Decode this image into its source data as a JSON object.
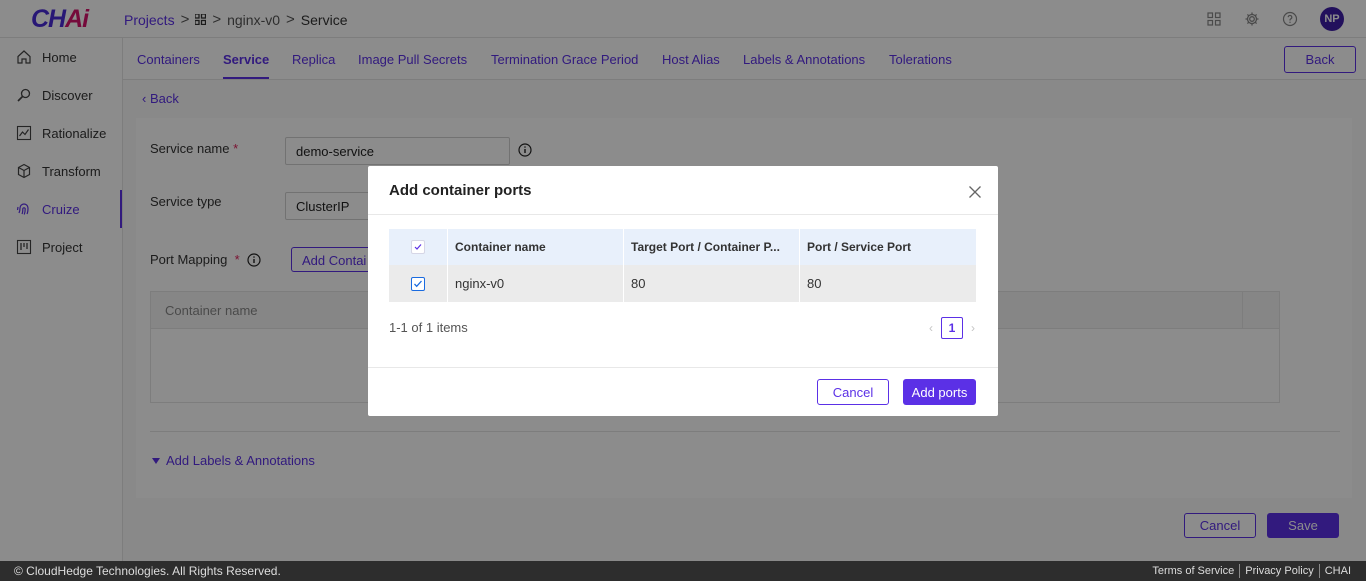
{
  "app": {
    "logo_main": "CH",
    "logo_accent": "Ai"
  },
  "breadcrumb": {
    "projects": "Projects",
    "app_name": "nginx-v0",
    "current": "Service",
    "sep": ">"
  },
  "header": {
    "avatar_initials": "NP"
  },
  "sidebar": {
    "items": [
      {
        "label": "Home",
        "icon": "home-icon"
      },
      {
        "label": "Discover",
        "icon": "discover-icon"
      },
      {
        "label": "Rationalize",
        "icon": "chart-icon"
      },
      {
        "label": "Transform",
        "icon": "cube-icon"
      },
      {
        "label": "Cruize",
        "icon": "fingerprint-icon",
        "active": true
      },
      {
        "label": "Project",
        "icon": "project-icon"
      }
    ]
  },
  "tabs": {
    "items": [
      "Containers",
      "Service",
      "Replica",
      "Image Pull Secrets",
      "Termination Grace Period",
      "Host Alias",
      "Labels & Annotations",
      "Tolerations"
    ],
    "active": "Service",
    "back_button": "Back"
  },
  "form": {
    "back_link": "Back",
    "service_name_label": "Service name",
    "service_name_value": "demo-service",
    "service_type_label": "Service type",
    "service_type_value": "ClusterIP",
    "port_mapping_label": "Port Mapping",
    "required_mark": "*",
    "add_container_button": "Add Contai",
    "table_header_container": "Container name",
    "labels_link": "Add Labels & Annotations",
    "cancel_button": "Cancel",
    "save_button": "Save"
  },
  "modal": {
    "title": "Add container ports",
    "columns": [
      "Container name",
      "Target Port / Container P...",
      "Port / Service Port"
    ],
    "rows": [
      {
        "container": "nginx-v0",
        "target_port": "80",
        "service_port": "80",
        "checked": true
      }
    ],
    "pager_info": "1-1 of 1 items",
    "current_page": "1",
    "cancel_button": "Cancel",
    "add_button": "Add ports"
  },
  "footer": {
    "copyright": "© CloudHedge Technologies. All Rights Reserved.",
    "terms": "Terms of Service",
    "privacy": "Privacy Policy",
    "brand": "CHAI"
  },
  "colors": {
    "accent": "#5b30e6",
    "logo_accent": "#d6136c",
    "footer_bg": "#2d2d2d"
  }
}
